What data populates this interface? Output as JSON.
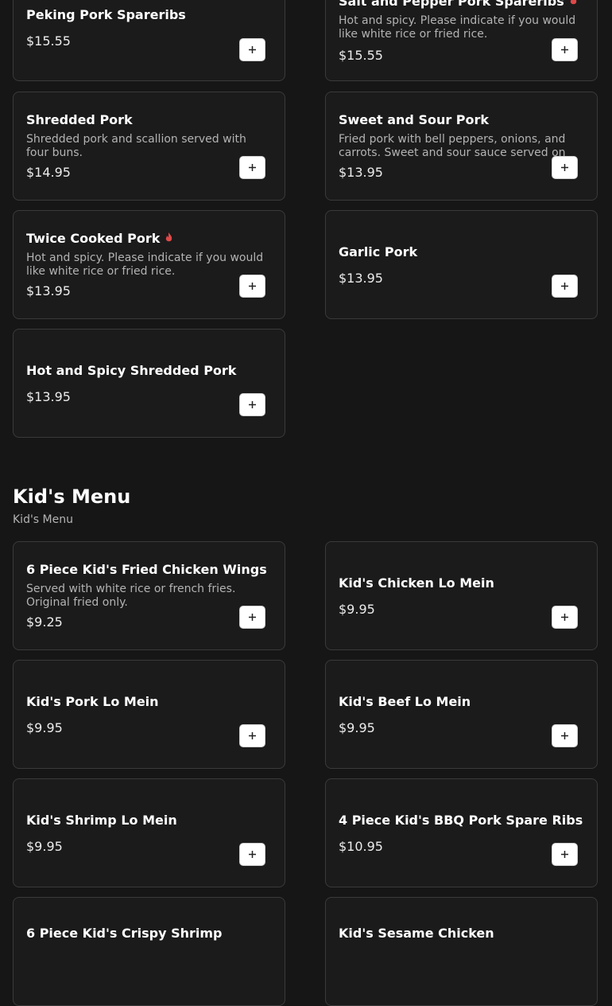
{
  "pork_items": [
    {
      "name": "Peking Pork Spareribs",
      "price": "$15.55"
    },
    {
      "name": "Salt and Pepper Pork Spareribs",
      "desc": "Hot and spicy. Please indicate if you would like white rice or fried rice.",
      "price": "$15.55",
      "spicy": true
    },
    {
      "name": "Shredded Pork",
      "desc": "Shredded pork and scallion served with four buns.",
      "price": "$14.95"
    },
    {
      "name": "Sweet and Sour Pork",
      "desc": "Fried pork with bell peppers, onions, and carrots. Sweet and sour sauce served on",
      "price": "$13.95"
    },
    {
      "name": "Twice Cooked Pork",
      "desc": "Hot and spicy. Please indicate if you would like white rice or fried rice.",
      "price": "$13.95",
      "spicy": true
    },
    {
      "name": "Garlic Pork",
      "price": "$13.95"
    },
    {
      "name": "Hot and Spicy Shredded Pork",
      "price": "$13.95"
    }
  ],
  "kids_section": {
    "title": "Kid's Menu",
    "subtitle": "Kid's Menu",
    "items": [
      {
        "name": "6 Piece Kid's Fried Chicken Wings",
        "desc": "Served with white rice or french fries. Original fried only.",
        "price": "$9.25"
      },
      {
        "name": "Kid's Chicken Lo Mein",
        "price": "$9.95"
      },
      {
        "name": "Kid's Pork Lo Mein",
        "price": "$9.95"
      },
      {
        "name": "Kid's Beef Lo Mein",
        "price": "$9.95"
      },
      {
        "name": "Kid's Shrimp Lo Mein",
        "price": "$9.95"
      },
      {
        "name": "4 Piece Kid's BBQ Pork Spare Ribs",
        "price": "$10.95"
      },
      {
        "name": "6 Piece Kid's Crispy Shrimp",
        "price": ""
      },
      {
        "name": "Kid's Sesame Chicken",
        "price": ""
      }
    ]
  },
  "icons": {
    "spicy": "chili-pepper-icon",
    "add": "plus-icon"
  },
  "colors": {
    "background": "#161616",
    "card": "#1b1b1b",
    "spicy": "#e04848"
  }
}
